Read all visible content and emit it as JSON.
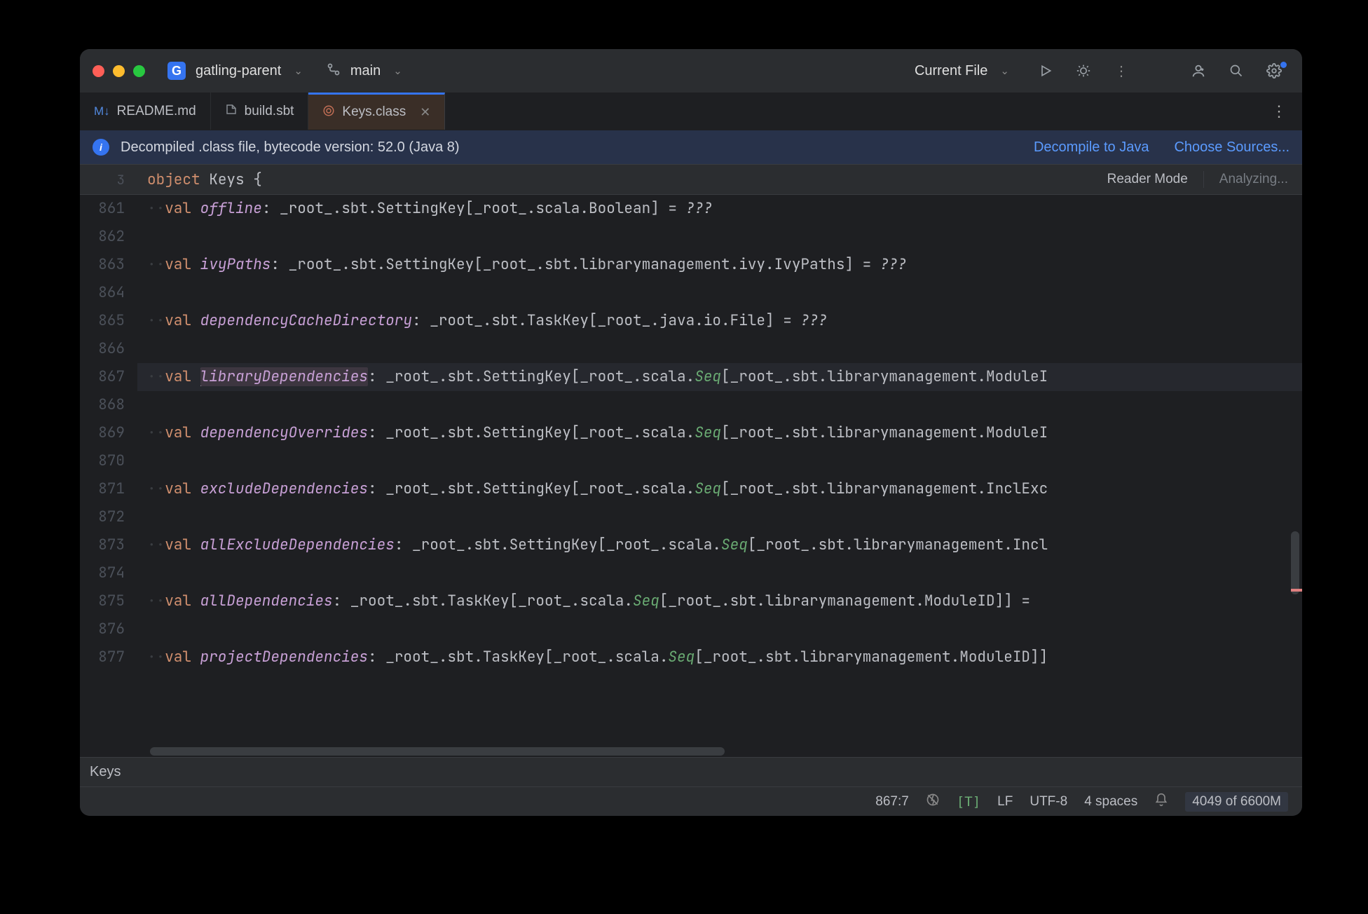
{
  "titlebar": {
    "project_badge": "G",
    "project_name": "gatling-parent",
    "branch": "main",
    "run_config": "Current File"
  },
  "tabs": [
    {
      "icon": "M↓",
      "label": "README.md",
      "active": false
    },
    {
      "icon": "⬡",
      "label": "build.sbt",
      "active": false
    },
    {
      "icon": "◎",
      "label": "Keys.class",
      "active": true
    }
  ],
  "banner": {
    "text": "Decompiled .class file, bytecode version: 52.0 (Java 8)",
    "link1": "Decompile to Java",
    "link2": "Choose Sources..."
  },
  "crumb": {
    "line": "3",
    "kw": "object",
    "name": "Keys",
    "brace": "{",
    "reader_mode": "Reader Mode",
    "analyzing": "Analyzing..."
  },
  "gutter_lines": [
    "861",
    "862",
    "863",
    "864",
    "865",
    "866",
    "867",
    "868",
    "869",
    "870",
    "871",
    "872",
    "873",
    "874",
    "875",
    "876",
    "877"
  ],
  "code": [
    {
      "val": "val ",
      "name": "offline",
      "rest": ": _root_.sbt.SettingKey[_root_.scala.Boolean] = ",
      "tail": "???"
    },
    {
      "empty": true
    },
    {
      "val": "val ",
      "name": "ivyPaths",
      "rest": ": _root_.sbt.SettingKey[_root_.sbt.librarymanagement.ivy.IvyPaths] = ",
      "tail": "???"
    },
    {
      "empty": true
    },
    {
      "val": "val ",
      "name": "dependencyCacheDirectory",
      "rest": ": _root_.sbt.TaskKey[_root_.java.io.File] = ",
      "tail": "???"
    },
    {
      "empty": true
    },
    {
      "val": "val ",
      "name": "libraryDependencies",
      "hl": true,
      "caret": true,
      "rest": ": _root_.sbt.SettingKey[_root_.scala.",
      "seq": "Seq",
      "rest2": "[_root_.sbt.librarymanagement.ModuleI"
    },
    {
      "empty": true
    },
    {
      "val": "val ",
      "name": "dependencyOverrides",
      "rest": ": _root_.sbt.SettingKey[_root_.scala.",
      "seq": "Seq",
      "rest2": "[_root_.sbt.librarymanagement.ModuleI"
    },
    {
      "empty": true
    },
    {
      "val": "val ",
      "name": "excludeDependencies",
      "rest": ": _root_.sbt.SettingKey[_root_.scala.",
      "seq": "Seq",
      "rest2": "[_root_.sbt.librarymanagement.InclExc"
    },
    {
      "empty": true
    },
    {
      "val": "val ",
      "name": "allExcludeDependencies",
      "rest": ": _root_.sbt.SettingKey[_root_.scala.",
      "seq": "Seq",
      "rest2": "[_root_.sbt.librarymanagement.Incl"
    },
    {
      "empty": true
    },
    {
      "val": "val ",
      "name": "allDependencies",
      "rest": ": _root_.sbt.TaskKey[_root_.scala.",
      "seq": "Seq",
      "rest2": "[_root_.sbt.librarymanagement.ModuleID]] = "
    },
    {
      "empty": true
    },
    {
      "val": "val ",
      "name": "projectDependencies",
      "rest": ": _root_.sbt.TaskKey[_root_.scala.",
      "seq": "Seq",
      "rest2": "[_root_.sbt.librarymanagement.ModuleID]]"
    }
  ],
  "breadcrumb2": "Keys",
  "status": {
    "pos": "867:7",
    "line_sep": "LF",
    "encoding": "UTF-8",
    "indent": "4 spaces",
    "mem": "4049 of 6600M",
    "t": "[T]"
  }
}
